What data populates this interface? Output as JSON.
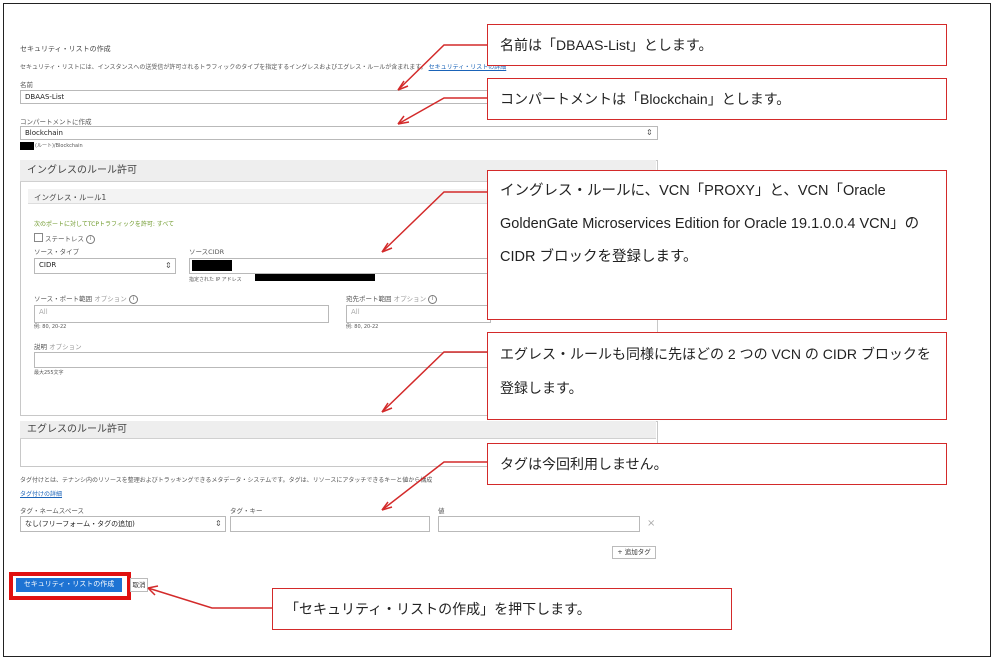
{
  "form": {
    "title": "セキュリティ・リストの作成",
    "description": "セキュリティ・リストには、インスタンスへの送受信が許可されるトラフィックのタイプを指定するイングレスおよびエグレス・ルールが含まれます。",
    "description_link": "セキュリティ・リストの詳細",
    "name_label": "名前",
    "name_value": "DBAAS-List",
    "compartment_label": "コンパートメントに作成",
    "compartment_value": "Blockchain",
    "compartment_path": "(ルート)/Blockchain"
  },
  "ingress": {
    "section_title": "イングレスのルール許可",
    "rule_title": "イングレス・ルール1",
    "allow_text": "次のポートに対してTCPトラフィックを許可: すべて",
    "stateless_label": "ステートレス",
    "source_type_label": "ソース・タイプ",
    "source_type_value": "CIDR",
    "source_cidr_label": "ソースCIDR",
    "source_cidr_hint": "指定された IP アドレス",
    "source_port_label": "ソース・ポート範囲",
    "optional": "オプション",
    "source_port_placeholder": "All",
    "source_port_example": "例: 80, 20-22",
    "dest_port_label": "宛先ポート範囲",
    "dest_port_placeholder": "All",
    "dest_port_example": "例: 80, 20-22",
    "desc_label": "説明",
    "desc_hint": "最大255文字"
  },
  "egress": {
    "section_title": "エグレスのルール許可"
  },
  "tags": {
    "description": "タグ付けとは、テナンシ内のリソースを整理およびトラッキングできるメタデータ・システムです。タグは、リソースにアタッチできるキーと値から構成",
    "details_link": "タグ付けの詳細",
    "namespace_label": "タグ・ネームスペース",
    "namespace_value": "なし(フリーフォーム・タグの追加)",
    "key_label": "タグ・キー",
    "value_label": "値",
    "add_tag": "+ 追加タグ",
    "remove": "×"
  },
  "buttons": {
    "create": "セキュリティ・リストの作成",
    "cancel": "取消"
  },
  "callouts": {
    "name": "名前は「DBAAS-List」とします。",
    "compartment": "コンパートメントは「Blockchain」とします。",
    "ingress": "イングレス・ルールに、VCN「PROXY」と、VCN「Oracle GoldenGate Microservices Edition for Oracle 19.1.0.0.4 VCN」の CIDR ブロックを登録します。",
    "egress": "エグレス・ルールも同様に先ほどの 2 つの VCN の CIDR ブロックを登録します。",
    "tags": "タグは今回利用しません。",
    "create": "「セキュリティ・リストの作成」を押下します。"
  },
  "colors": {
    "annotation_red": "#d32a2a",
    "primary_button": "#1e73d3",
    "link": "#1a63b8"
  }
}
